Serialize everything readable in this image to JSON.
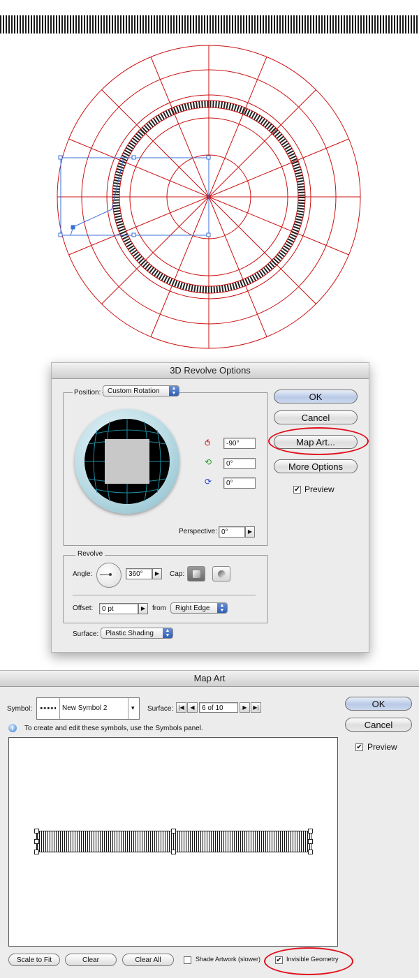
{
  "revolve": {
    "title": "3D Revolve Options",
    "position_label": "Position:",
    "position_value": "Custom Rotation",
    "rotation_x": "-90°",
    "rotation_y": "0°",
    "rotation_z": "0°",
    "perspective_label": "Perspective:",
    "perspective_value": "0°",
    "revolve_group": "Revolve",
    "angle_label": "Angle:",
    "angle_value": "360°",
    "cap_label": "Cap:",
    "offset_label": "Offset:",
    "offset_value": "0 pt",
    "from_label": "from",
    "from_value": "Right Edge",
    "surface_label": "Surface:",
    "surface_value": "Plastic Shading",
    "ok": "OK",
    "cancel": "Cancel",
    "map_art": "Map Art...",
    "more_options": "More Options",
    "preview": "Preview",
    "preview_checked": true
  },
  "mapart": {
    "title": "Map Art",
    "symbol_label": "Symbol:",
    "symbol_value": "New Symbol 2",
    "surface_label": "Surface:",
    "surface_value": "6 of 10",
    "info_text": "To create and edit these symbols, use the Symbols panel.",
    "ok": "OK",
    "cancel": "Cancel",
    "preview": "Preview",
    "preview_checked": true,
    "scale_to_fit": "Scale to Fit",
    "clear": "Clear",
    "clear_all": "Clear All",
    "shade_artwork": "Shade Artwork (slower)",
    "shade_checked": false,
    "invisible_geometry": "Invisible Geometry",
    "invisible_checked": true
  },
  "colors": {
    "highlight": "#e0101c",
    "wireframe": "#cc1111",
    "selection": "#3a6fd8"
  }
}
